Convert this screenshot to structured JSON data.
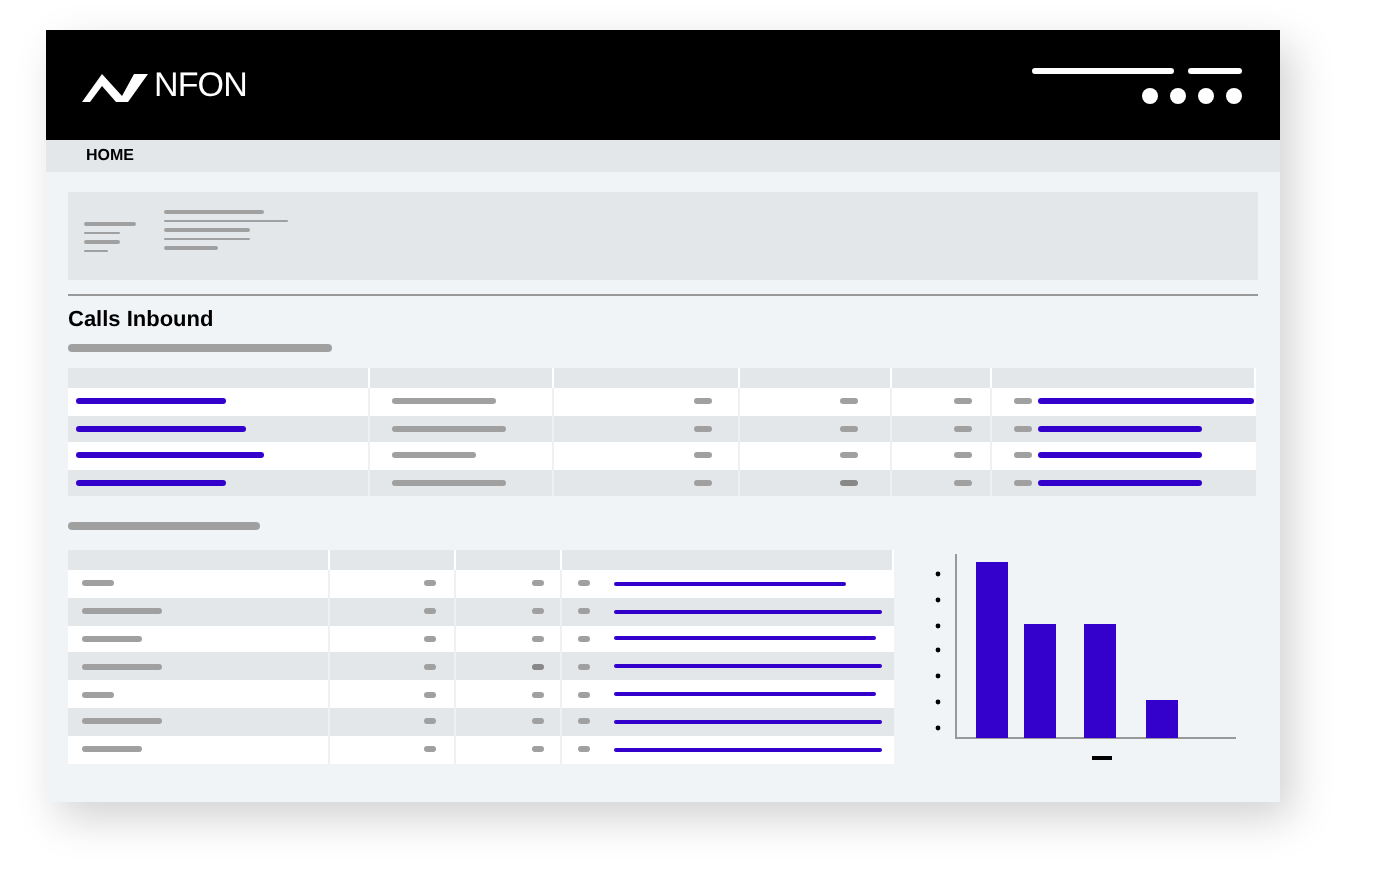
{
  "header": {
    "brand": "NFON"
  },
  "nav": {
    "items": [
      {
        "label": "HOME",
        "selected": true
      }
    ]
  },
  "section": {
    "title": "Calls Inbound"
  }
}
